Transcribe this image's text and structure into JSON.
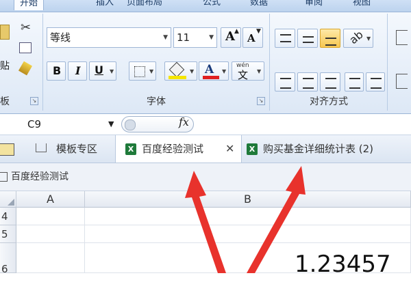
{
  "ribbon_tabs": [
    "开始",
    "插入",
    "页面布局",
    "公式",
    "数据",
    "审阅",
    "视图"
  ],
  "clipboard": {
    "label": "板",
    "paste_label": "贴"
  },
  "font": {
    "name": "等线",
    "size": "11",
    "grow": "A",
    "shrink": "A",
    "bold": "B",
    "italic": "I",
    "underline": "U",
    "font_color_glyph": "A",
    "phonetic": "wén",
    "phonetic_char": "文",
    "label": "字体",
    "highlight_color": "#f5e500",
    "font_color": "#e02020"
  },
  "alignment": {
    "label": "对齐方式"
  },
  "formula_bar": {
    "name_box": "C9",
    "fx": "fx"
  },
  "doc_tabs": [
    {
      "label": "模板专区"
    },
    {
      "label": "百度经验测试",
      "close": "✕"
    },
    {
      "label": "购买基金详细统计表 (2)"
    }
  ],
  "sheet": {
    "title": "百度经验测试",
    "columns": [
      "A",
      "B"
    ],
    "rows": [
      "4",
      "5",
      "6"
    ],
    "value": "1.23457"
  },
  "annotation_color": "#e8322c"
}
